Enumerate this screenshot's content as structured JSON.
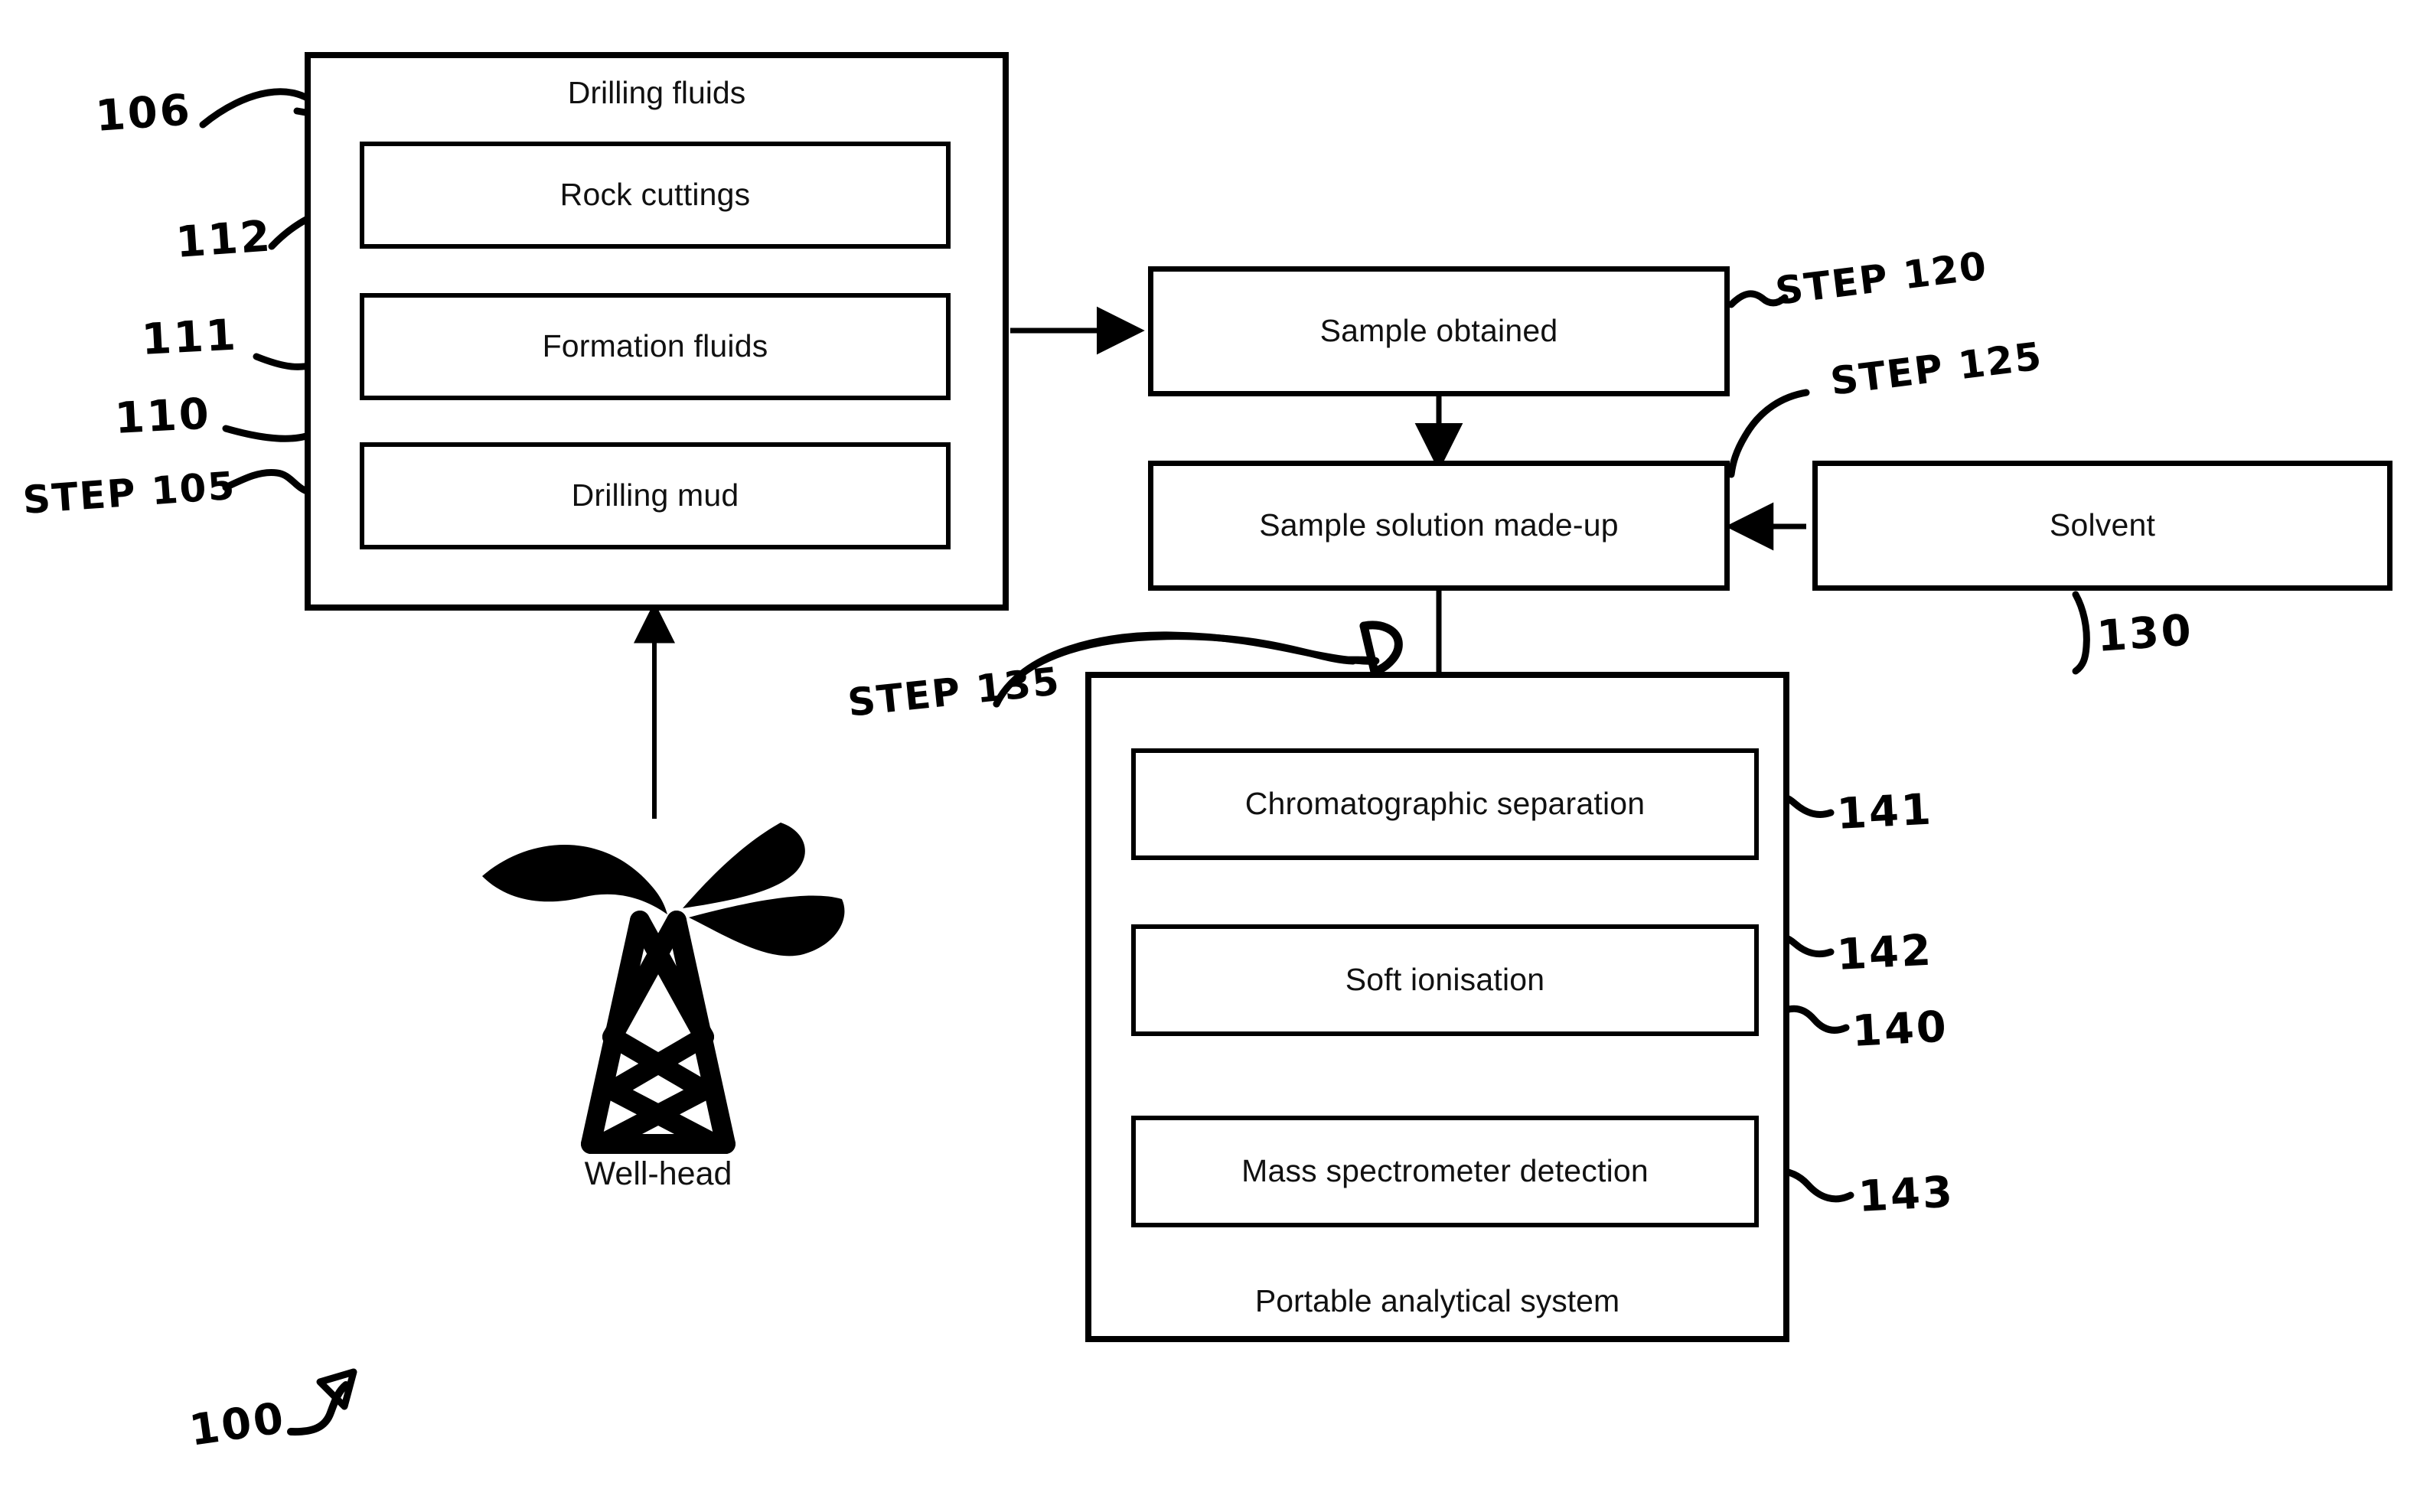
{
  "figure": {
    "reference_numeral": "100",
    "source_group": {
      "title": "Drilling fluids",
      "ref": "106",
      "step_ref": "STEP 105",
      "items": [
        {
          "label": "Rock cuttings",
          "ref": "112"
        },
        {
          "label": "Formation fluids",
          "ref": "111"
        },
        {
          "label": "Drilling mud",
          "ref": "110"
        }
      ]
    },
    "wellhead": {
      "caption": "Well-head",
      "icon": "oil-derrick-icon"
    },
    "process": [
      {
        "label": "Sample obtained",
        "step_ref": "STEP 120"
      },
      {
        "label": "Sample solution made-up",
        "step_ref": "STEP 125"
      }
    ],
    "solvent": {
      "label": "Solvent",
      "ref": "130"
    },
    "analytical_system": {
      "title": "Portable analytical system",
      "ref": "140",
      "step_ref": "STEP 135",
      "stages": [
        {
          "label": "Chromatographic separation",
          "ref": "141"
        },
        {
          "label": "Soft ionisation",
          "ref": "142"
        },
        {
          "label": "Mass spectrometer detection",
          "ref": "143"
        }
      ]
    },
    "markers": {
      "drilling_fluids_pointer": "D",
      "analytical_pointer": "D"
    }
  },
  "colors": {
    "ink": "#000000",
    "paper": "#ffffff",
    "text": "#111111"
  }
}
